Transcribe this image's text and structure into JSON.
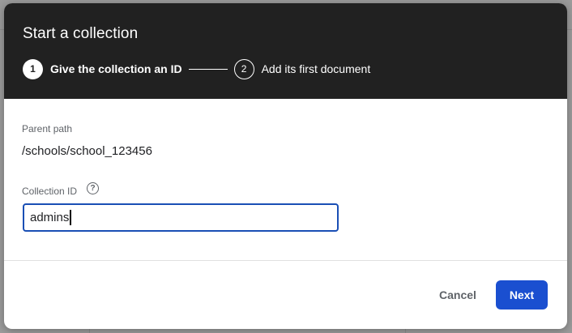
{
  "dialog": {
    "title": "Start a collection",
    "steps": [
      {
        "number": "1",
        "label": "Give the collection an ID",
        "active": true
      },
      {
        "number": "2",
        "label": "Add its first document",
        "active": false
      }
    ]
  },
  "form": {
    "parent_path_label": "Parent path",
    "parent_path_value": "/schools/school_123456",
    "collection_id_label": "Collection ID",
    "help_icon_glyph": "?",
    "collection_id_value": "admins"
  },
  "actions": {
    "cancel_label": "Cancel",
    "next_label": "Next"
  },
  "colors": {
    "header_bg": "#212121",
    "primary": "#1a4fd0",
    "input_border": "#1a4fb5"
  },
  "icons": [
    "help-circle-icon"
  ]
}
